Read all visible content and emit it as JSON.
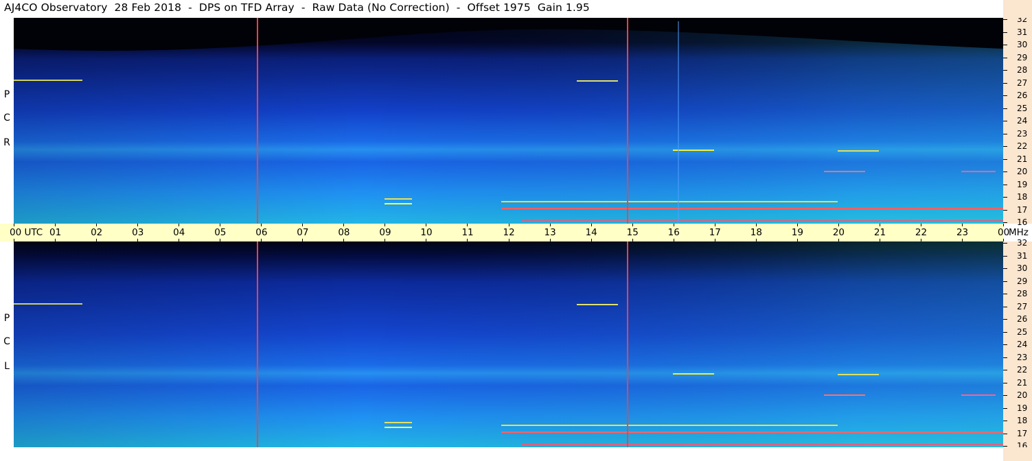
{
  "title": "AJ4CO Observatory  28 Feb 2018  -  DPS on TFD Array  -  Raw Data (No Correction)  -  Offset 1975  Gain 1.95",
  "panels": [
    {
      "id": "rcp",
      "label_chars": [
        "P",
        "C",
        "R"
      ]
    },
    {
      "id": "lcp",
      "label_chars": [
        "P",
        "C",
        "L"
      ]
    }
  ],
  "time_axis": {
    "labels": [
      "00",
      "01",
      "02",
      "03",
      "04",
      "05",
      "06",
      "07",
      "08",
      "09",
      "10",
      "11",
      "12",
      "13",
      "14",
      "15",
      "16",
      "17",
      "18",
      "19",
      "20",
      "21",
      "22",
      "23",
      "00"
    ],
    "utc_label": "UTC"
  },
  "freq_axis": {
    "unit": "MHz",
    "labels": [
      "32",
      "31",
      "30",
      "29",
      "28",
      "27",
      "26",
      "25",
      "24",
      "23",
      "22",
      "21",
      "20",
      "19",
      "18",
      "17",
      "16"
    ]
  },
  "colors": {
    "background": "#ffffff",
    "utc_band": "#ffffc6",
    "freq_band": "#fbe6cf",
    "spectrogram_dark": "#00000a",
    "spectrogram_low": "#0a2a9a",
    "spectrogram_mid": "#1a6ef0",
    "spectrogram_high": "#22d0b4",
    "marker_line": "#ff4040"
  },
  "markers_utc": [
    5.9,
    14.9
  ]
}
